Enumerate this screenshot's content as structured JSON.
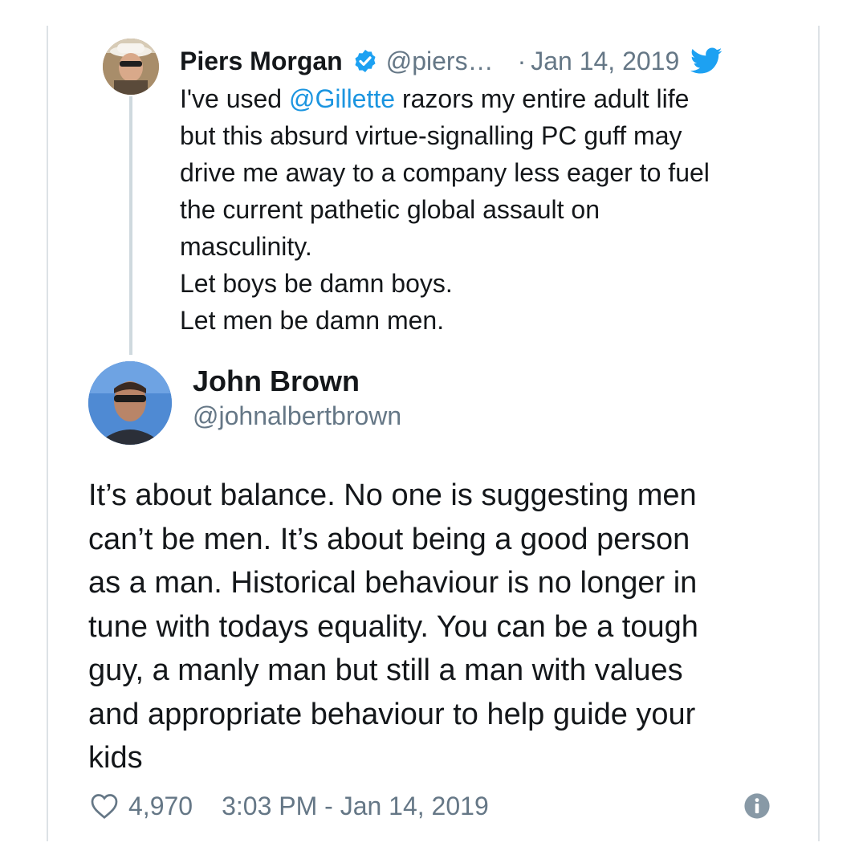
{
  "parent_tweet": {
    "name": "Piers Morgan",
    "handle": "@piers…",
    "separator": "·",
    "date": "Jan 14, 2019",
    "body_prefix": "I've used ",
    "mention": "@Gillette",
    "body_first_rest": " razors my entire adult life",
    "body_lines": [
      "but this absurd virtue-signalling PC guff may",
      "drive me away to a company less eager to fuel",
      "the current pathetic global assault on",
      "masculinity.",
      "Let boys be damn boys.",
      "Let men be damn men."
    ],
    "icons": {
      "verified": "verified-badge-icon",
      "platform": "twitter-bird-icon"
    }
  },
  "reply_tweet": {
    "name": "John Brown",
    "handle": "@johnalbertbrown",
    "body_lines": [
      "It’s about balance. No one is suggesting men",
      "can’t be men. It’s about being a good person",
      "as a man. Historical behaviour is no longer in",
      "tune with todays equality. You can be a tough",
      "guy, a manly man but still a man with values",
      "and appropriate behaviour to help guide your",
      "kids"
    ],
    "likes": "4,970",
    "timestamp": "3:03 PM - Jan 14, 2019",
    "icons": {
      "like": "heart-icon",
      "info": "info-icon"
    }
  },
  "colors": {
    "link": "#1b95e0",
    "secondary_text": "#657786",
    "primary_text": "#14171a",
    "verified": "#1da1f2",
    "frame_line": "#dde2e6"
  }
}
